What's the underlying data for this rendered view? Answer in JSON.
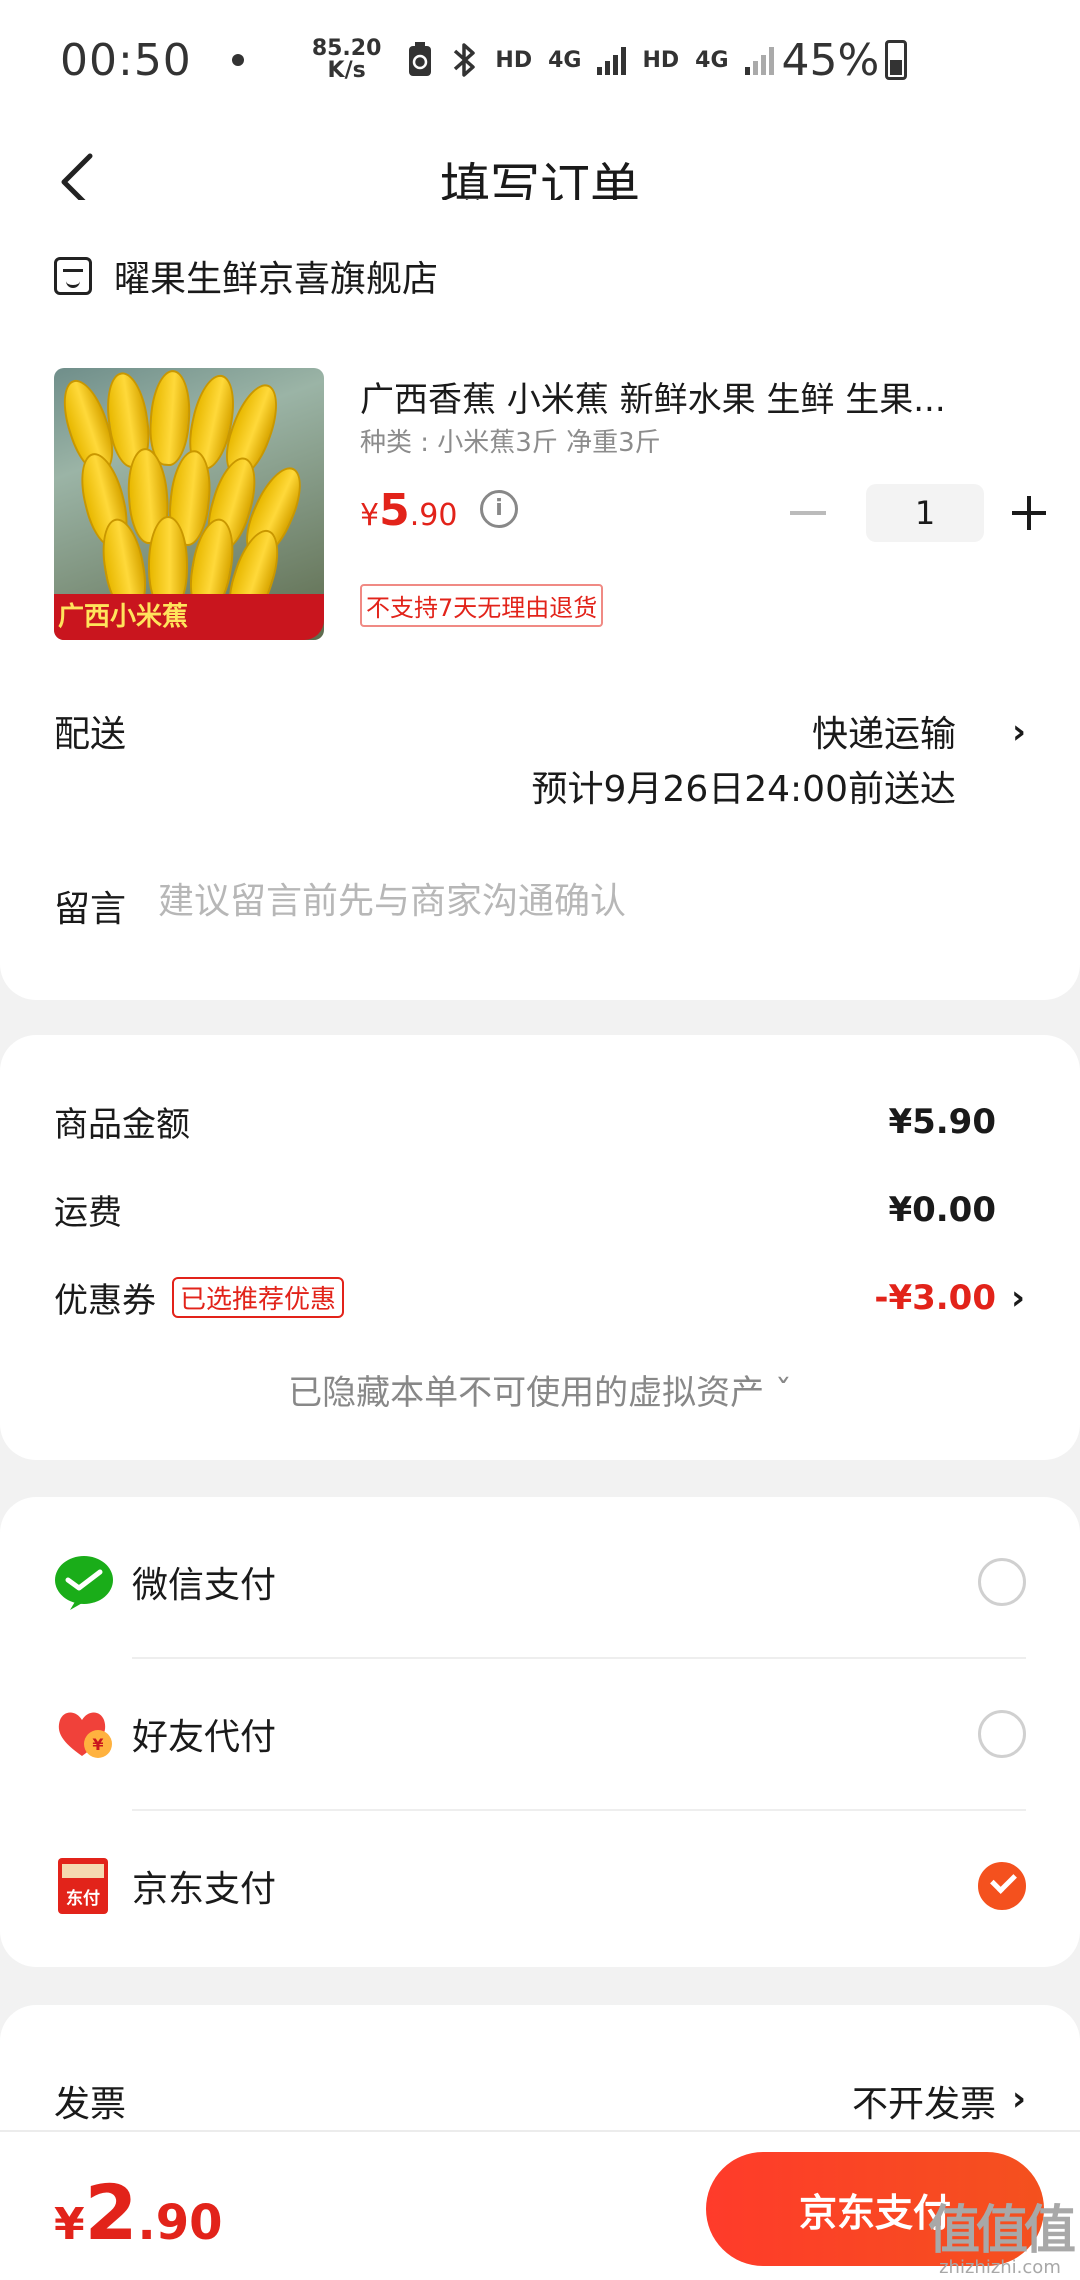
{
  "status_bar": {
    "time": "00:50",
    "net_speed_value": "85.20",
    "net_speed_unit": "K/s",
    "hd1": "HD",
    "net1": "4G",
    "hd2": "HD",
    "net2": "4G",
    "battery_percent": "45%"
  },
  "header": {
    "title": "填写订单"
  },
  "shop": {
    "name": "曜果生鲜京喜旗舰店"
  },
  "product": {
    "image_label": "广西小米蕉",
    "title": "广西香蕉 小米蕉   新鲜水果 生鲜 生果...",
    "spec": "种类 : 小米蕉3斤 净重3斤",
    "price_symbol": "¥",
    "price_int": "5",
    "price_dec": ".90",
    "quantity": "1",
    "tag": "不支持7天无理由退货"
  },
  "delivery": {
    "label": "配送",
    "method": "快递运输",
    "eta": "预计9月26日24:00前送达"
  },
  "message": {
    "label": "留言",
    "placeholder": "建议留言前先与商家沟通确认"
  },
  "amounts": {
    "goods_label": "商品金额",
    "goods_value": "¥5.90",
    "shipping_label": "运费",
    "shipping_value": "¥0.00",
    "coupon_label": "优惠券",
    "coupon_tag": "已选推荐优惠",
    "coupon_value": "-¥3.00",
    "hidden_assets": "已隐藏本单不可使用的虚拟资产 ˇ"
  },
  "payment": {
    "options": [
      {
        "label": "微信支付",
        "icon": "wechat-pay-icon",
        "selected": false
      },
      {
        "label": "好友代付",
        "icon": "friend-pay-icon",
        "selected": false
      },
      {
        "label": "京东支付",
        "icon": "jd-pay-icon",
        "icon_text": "东付",
        "selected": true
      }
    ]
  },
  "invoice": {
    "label": "发票",
    "value": "不开发票"
  },
  "bottom": {
    "total_symbol": "¥",
    "total_int": "2",
    "total_dec": ".90",
    "pay_button": "京东支付"
  },
  "watermark": {
    "main": "值值值",
    "sub": "zhizhizhi.com"
  },
  "colors": {
    "accent": "#e2231a",
    "pay_button": "#f4511e",
    "wechat_green": "#1aad19"
  }
}
